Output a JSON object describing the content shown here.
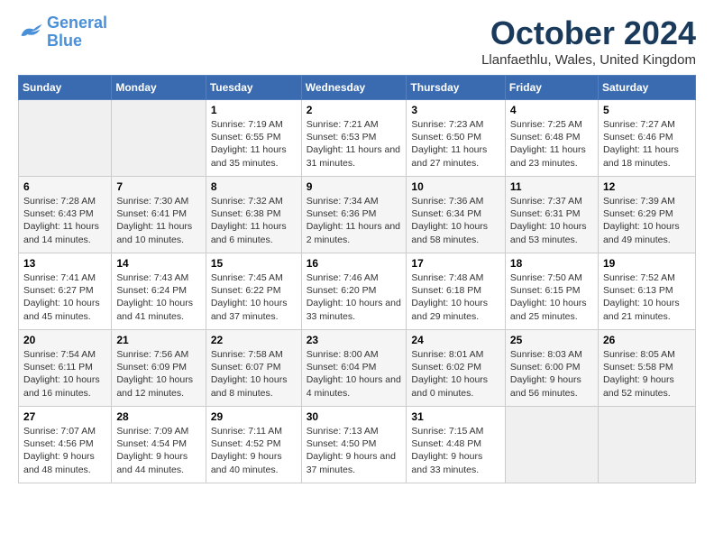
{
  "header": {
    "logo_line1": "General",
    "logo_line2": "Blue",
    "month_title": "October 2024",
    "location": "Llanfaethlu, Wales, United Kingdom"
  },
  "days_of_week": [
    "Sunday",
    "Monday",
    "Tuesday",
    "Wednesday",
    "Thursday",
    "Friday",
    "Saturday"
  ],
  "weeks": [
    [
      {
        "day": "",
        "info": ""
      },
      {
        "day": "",
        "info": ""
      },
      {
        "day": "1",
        "info": "Sunrise: 7:19 AM\nSunset: 6:55 PM\nDaylight: 11 hours and 35 minutes."
      },
      {
        "day": "2",
        "info": "Sunrise: 7:21 AM\nSunset: 6:53 PM\nDaylight: 11 hours and 31 minutes."
      },
      {
        "day": "3",
        "info": "Sunrise: 7:23 AM\nSunset: 6:50 PM\nDaylight: 11 hours and 27 minutes."
      },
      {
        "day": "4",
        "info": "Sunrise: 7:25 AM\nSunset: 6:48 PM\nDaylight: 11 hours and 23 minutes."
      },
      {
        "day": "5",
        "info": "Sunrise: 7:27 AM\nSunset: 6:46 PM\nDaylight: 11 hours and 18 minutes."
      }
    ],
    [
      {
        "day": "6",
        "info": "Sunrise: 7:28 AM\nSunset: 6:43 PM\nDaylight: 11 hours and 14 minutes."
      },
      {
        "day": "7",
        "info": "Sunrise: 7:30 AM\nSunset: 6:41 PM\nDaylight: 11 hours and 10 minutes."
      },
      {
        "day": "8",
        "info": "Sunrise: 7:32 AM\nSunset: 6:38 PM\nDaylight: 11 hours and 6 minutes."
      },
      {
        "day": "9",
        "info": "Sunrise: 7:34 AM\nSunset: 6:36 PM\nDaylight: 11 hours and 2 minutes."
      },
      {
        "day": "10",
        "info": "Sunrise: 7:36 AM\nSunset: 6:34 PM\nDaylight: 10 hours and 58 minutes."
      },
      {
        "day": "11",
        "info": "Sunrise: 7:37 AM\nSunset: 6:31 PM\nDaylight: 10 hours and 53 minutes."
      },
      {
        "day": "12",
        "info": "Sunrise: 7:39 AM\nSunset: 6:29 PM\nDaylight: 10 hours and 49 minutes."
      }
    ],
    [
      {
        "day": "13",
        "info": "Sunrise: 7:41 AM\nSunset: 6:27 PM\nDaylight: 10 hours and 45 minutes."
      },
      {
        "day": "14",
        "info": "Sunrise: 7:43 AM\nSunset: 6:24 PM\nDaylight: 10 hours and 41 minutes."
      },
      {
        "day": "15",
        "info": "Sunrise: 7:45 AM\nSunset: 6:22 PM\nDaylight: 10 hours and 37 minutes."
      },
      {
        "day": "16",
        "info": "Sunrise: 7:46 AM\nSunset: 6:20 PM\nDaylight: 10 hours and 33 minutes."
      },
      {
        "day": "17",
        "info": "Sunrise: 7:48 AM\nSunset: 6:18 PM\nDaylight: 10 hours and 29 minutes."
      },
      {
        "day": "18",
        "info": "Sunrise: 7:50 AM\nSunset: 6:15 PM\nDaylight: 10 hours and 25 minutes."
      },
      {
        "day": "19",
        "info": "Sunrise: 7:52 AM\nSunset: 6:13 PM\nDaylight: 10 hours and 21 minutes."
      }
    ],
    [
      {
        "day": "20",
        "info": "Sunrise: 7:54 AM\nSunset: 6:11 PM\nDaylight: 10 hours and 16 minutes."
      },
      {
        "day": "21",
        "info": "Sunrise: 7:56 AM\nSunset: 6:09 PM\nDaylight: 10 hours and 12 minutes."
      },
      {
        "day": "22",
        "info": "Sunrise: 7:58 AM\nSunset: 6:07 PM\nDaylight: 10 hours and 8 minutes."
      },
      {
        "day": "23",
        "info": "Sunrise: 8:00 AM\nSunset: 6:04 PM\nDaylight: 10 hours and 4 minutes."
      },
      {
        "day": "24",
        "info": "Sunrise: 8:01 AM\nSunset: 6:02 PM\nDaylight: 10 hours and 0 minutes."
      },
      {
        "day": "25",
        "info": "Sunrise: 8:03 AM\nSunset: 6:00 PM\nDaylight: 9 hours and 56 minutes."
      },
      {
        "day": "26",
        "info": "Sunrise: 8:05 AM\nSunset: 5:58 PM\nDaylight: 9 hours and 52 minutes."
      }
    ],
    [
      {
        "day": "27",
        "info": "Sunrise: 7:07 AM\nSunset: 4:56 PM\nDaylight: 9 hours and 48 minutes."
      },
      {
        "day": "28",
        "info": "Sunrise: 7:09 AM\nSunset: 4:54 PM\nDaylight: 9 hours and 44 minutes."
      },
      {
        "day": "29",
        "info": "Sunrise: 7:11 AM\nSunset: 4:52 PM\nDaylight: 9 hours and 40 minutes."
      },
      {
        "day": "30",
        "info": "Sunrise: 7:13 AM\nSunset: 4:50 PM\nDaylight: 9 hours and 37 minutes."
      },
      {
        "day": "31",
        "info": "Sunrise: 7:15 AM\nSunset: 4:48 PM\nDaylight: 9 hours and 33 minutes."
      },
      {
        "day": "",
        "info": ""
      },
      {
        "day": "",
        "info": ""
      }
    ]
  ]
}
